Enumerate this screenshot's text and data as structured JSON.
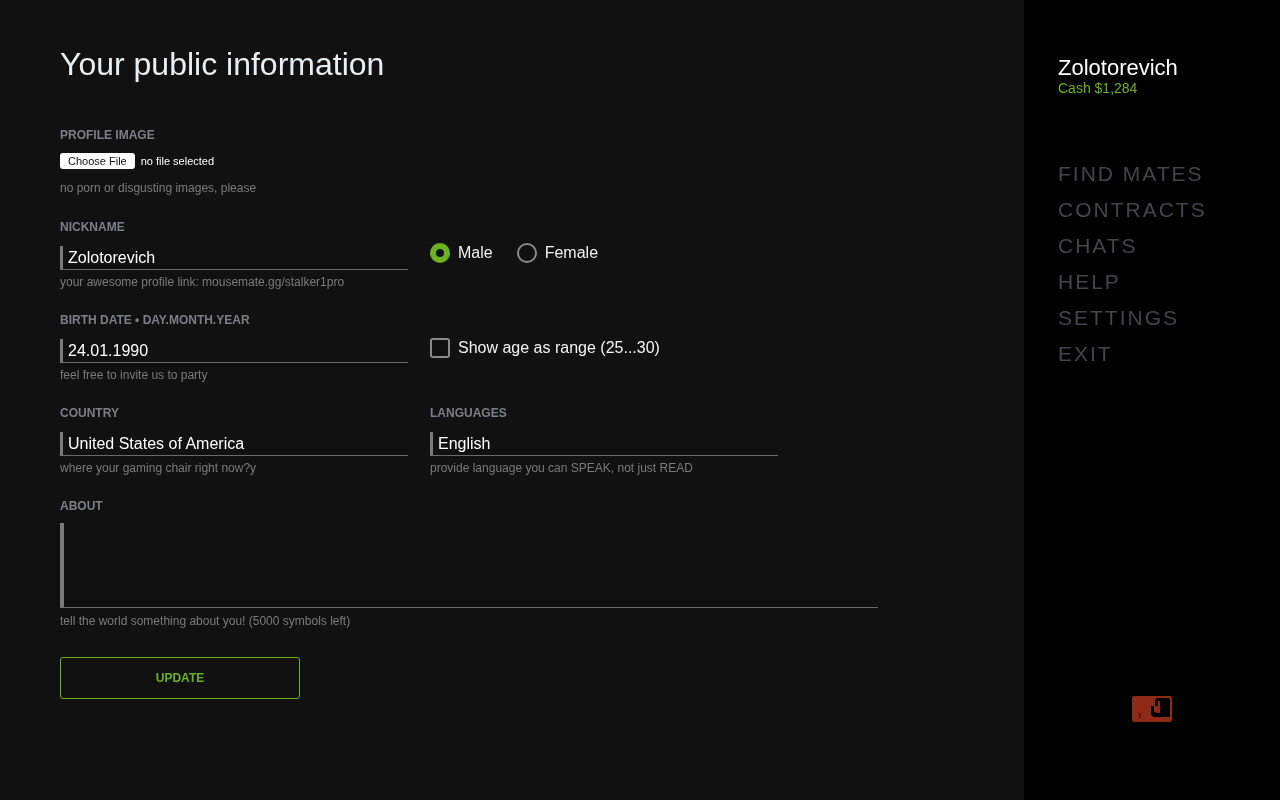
{
  "page_title": "Your public information",
  "profile_image": {
    "label": "PROFILE IMAGE",
    "button": "Choose File",
    "status": "no file selected",
    "hint": "no porn or disgusting images, please"
  },
  "nickname": {
    "label": "NICKNAME",
    "value": "Zolotorevich",
    "hint": "your awesome profile link: mousemate.gg/stalker1pro"
  },
  "gender": [
    {
      "label": "Male",
      "selected": true
    },
    {
      "label": "Female",
      "selected": false
    }
  ],
  "birth_date": {
    "label": "BIRTH DATE • DAY.MONTH.YEAR",
    "value": "24.01.1990",
    "hint": "feel free to invite us to party"
  },
  "age_range": {
    "label": "Show age as range (25...30)",
    "checked": false
  },
  "country": {
    "label": "COUNTRY",
    "value": "United States of America",
    "hint": "where your gaming chair right now?y"
  },
  "languages": {
    "label": "LANGUAGES",
    "value": "English",
    "hint": "provide language you can SPEAK, not just READ"
  },
  "about": {
    "label": "ABOUT",
    "hint": "tell the world something about you! (5000 symbols left)"
  },
  "update_button": "UPDATE",
  "sidebar": {
    "username": "Zolotorevich",
    "cash": "Cash $1,284",
    "nav": [
      "FIND MATES",
      "CONTRACTS",
      "CHATS",
      "HELP",
      "SETTINGS",
      "EXIT"
    ]
  }
}
